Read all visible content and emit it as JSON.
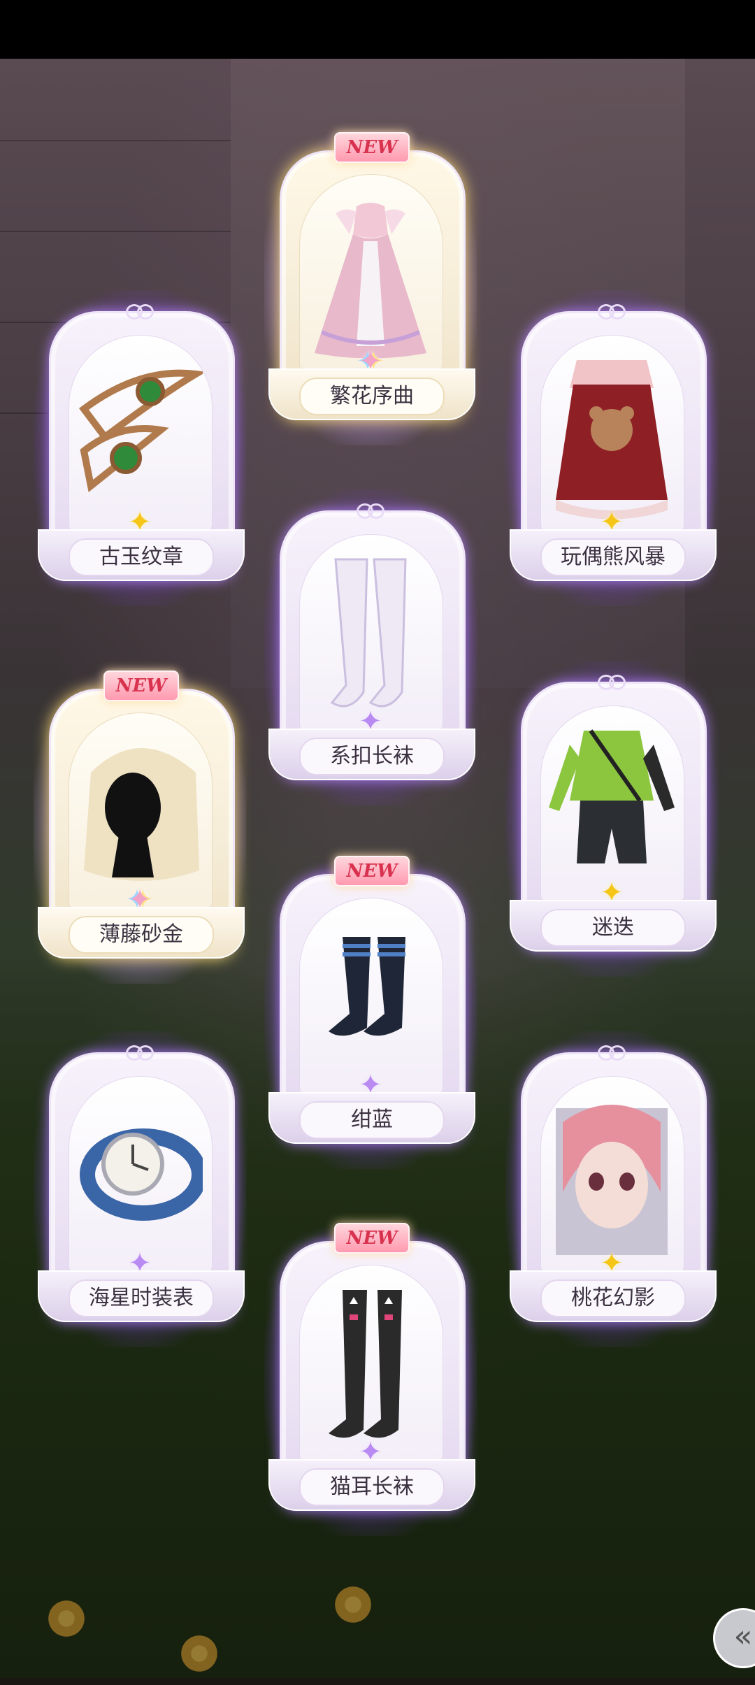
{
  "cards": [
    {
      "name": "繁花序曲",
      "badge": "NEW",
      "star": "rainbow"
    },
    {
      "name": "古玉纹章",
      "badge": "",
      "star": "yellow"
    },
    {
      "name": "玩偶熊风暴",
      "badge": "",
      "star": "yellow"
    },
    {
      "name": "系扣长袜",
      "badge": "",
      "star": "purple"
    },
    {
      "name": "薄藤砂金",
      "badge": "NEW",
      "star": "rainbow"
    },
    {
      "name": "迷迭",
      "badge": "",
      "star": "yellow"
    },
    {
      "name": "绀蓝",
      "badge": "NEW",
      "star": "purple"
    },
    {
      "name": "海星时装表",
      "badge": "",
      "star": "purple"
    },
    {
      "name": "桃花幻影",
      "badge": "",
      "star": "yellow"
    },
    {
      "name": "猫耳长袜",
      "badge": "NEW",
      "star": "purple"
    }
  ],
  "colors": {
    "glow_purple": "#aa6eff",
    "glow_gold": "#ffe68c",
    "badge_text": "#d8324f",
    "star_yellow": "#f5c518",
    "star_purple": "#b98af2"
  },
  "icons": {
    "star": "four-point-star-icon",
    "back": "back-chevron-icon"
  },
  "back_glyph": "«",
  "star_glyph": "✦"
}
